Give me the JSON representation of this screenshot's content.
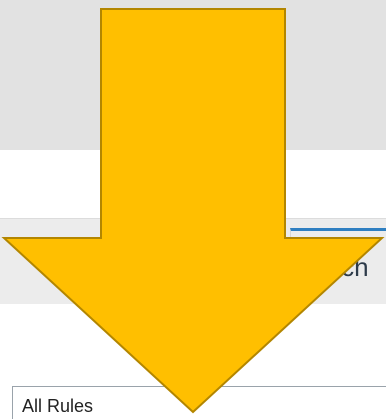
{
  "search": {
    "tab_label": "arch"
  },
  "filter": {
    "selected": "All Rules"
  },
  "colors": {
    "arrow_fill": "#ffbf00",
    "arrow_stroke": "#b38600",
    "tab_accent": "#2f7fc1"
  },
  "overlay": {
    "icon": "down-arrow-icon"
  }
}
